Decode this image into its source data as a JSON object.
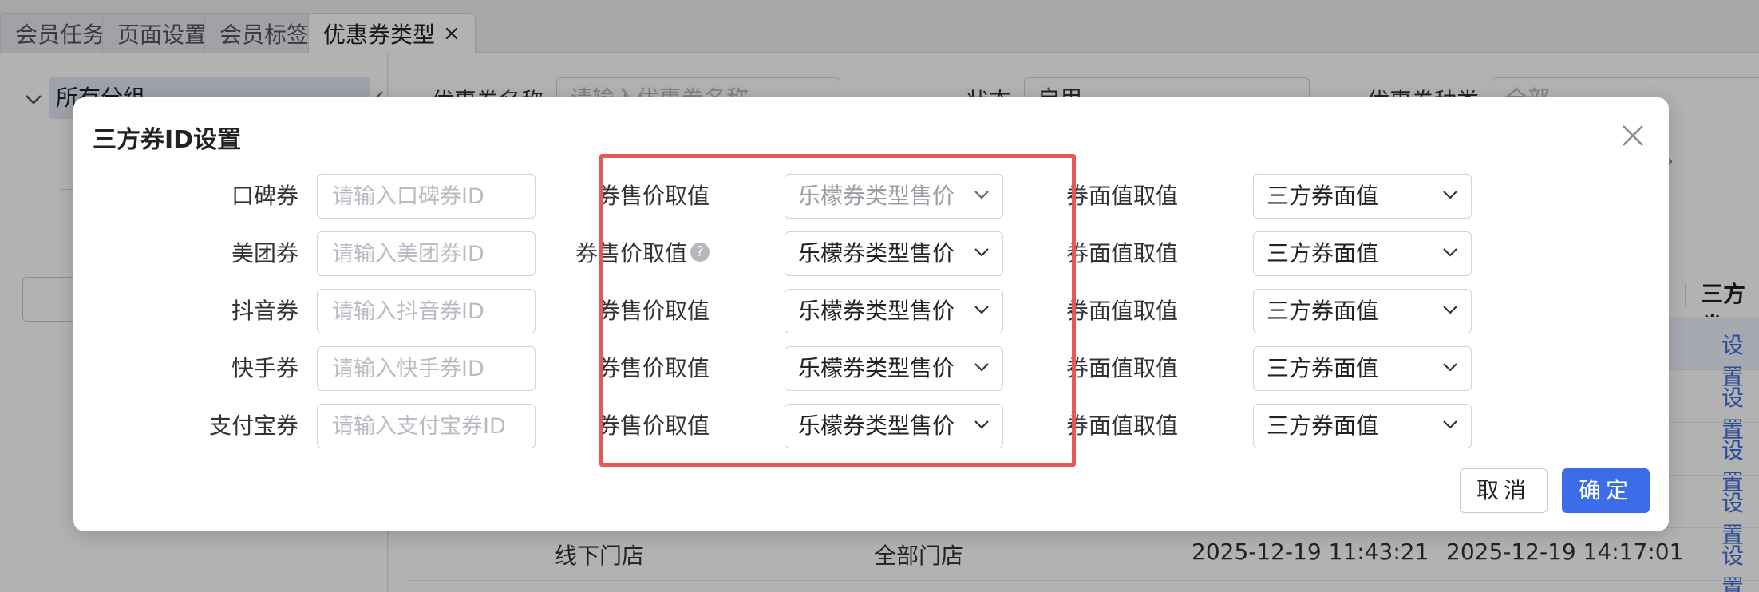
{
  "tabs": [
    {
      "label": "会员任务",
      "active": false
    },
    {
      "label": "页面设置",
      "active": false
    },
    {
      "label": "会员标签",
      "active": false
    },
    {
      "label": "优惠券类型",
      "active": true
    }
  ],
  "tab_close_glyph": "×",
  "sidebar": {
    "root_label": "所有分组"
  },
  "filters": {
    "coupon_name_label": "优惠券名称",
    "coupon_name_placeholder": "请输入优惠券名称",
    "status_label": "状态",
    "status_value": "启用",
    "coupon_type_label": "优惠券种类",
    "coupon_type_placeholder": "全部",
    "expand_glyph": "»"
  },
  "table": {
    "partial_header": "三方券",
    "rows": [
      {
        "action": "设置"
      },
      {
        "action": "设置"
      },
      {
        "action": "设置"
      },
      {
        "action": "设置"
      },
      {
        "channel": "线下门店",
        "store": "全部门店",
        "created": "2025-12-19 11:43:21",
        "updated": "2025-12-19 14:17:01",
        "action": "设置"
      }
    ]
  },
  "modal": {
    "title": "三方券ID设置",
    "rows": [
      {
        "label": "口碑券",
        "placeholder": "请输入口碑券ID",
        "sale_label": "券售价取值",
        "sale_value": "乐檬券类型售价",
        "sale_is_placeholder": true,
        "sale_help": false,
        "face_label": "券面值取值",
        "face_value": "三方券面值"
      },
      {
        "label": "美团券",
        "placeholder": "请输入美团券ID",
        "sale_label": "券售价取值",
        "sale_value": "乐檬券类型售价",
        "sale_is_placeholder": false,
        "sale_help": true,
        "face_label": "券面值取值",
        "face_value": "三方券面值"
      },
      {
        "label": "抖音券",
        "placeholder": "请输入抖音券ID",
        "sale_label": "券售价取值",
        "sale_value": "乐檬券类型售价",
        "sale_is_placeholder": false,
        "sale_help": false,
        "face_label": "券面值取值",
        "face_value": "三方券面值"
      },
      {
        "label": "快手券",
        "placeholder": "请输入快手券ID",
        "sale_label": "券售价取值",
        "sale_value": "乐檬券类型售价",
        "sale_is_placeholder": false,
        "sale_help": false,
        "face_label": "券面值取值",
        "face_value": "三方券面值"
      },
      {
        "label": "支付宝券",
        "placeholder": "请输入支付宝券ID",
        "sale_label": "券售价取值",
        "sale_value": "乐檬券类型售价",
        "sale_is_placeholder": false,
        "sale_help": false,
        "face_label": "券面值取值",
        "face_value": "三方券面值"
      }
    ],
    "help_glyph": "?",
    "cancel_label": "取消",
    "confirm_label": "确定"
  },
  "colors": {
    "primary": "#3d6ce8",
    "highlight": "#e85656",
    "link": "#3b6fd9"
  }
}
